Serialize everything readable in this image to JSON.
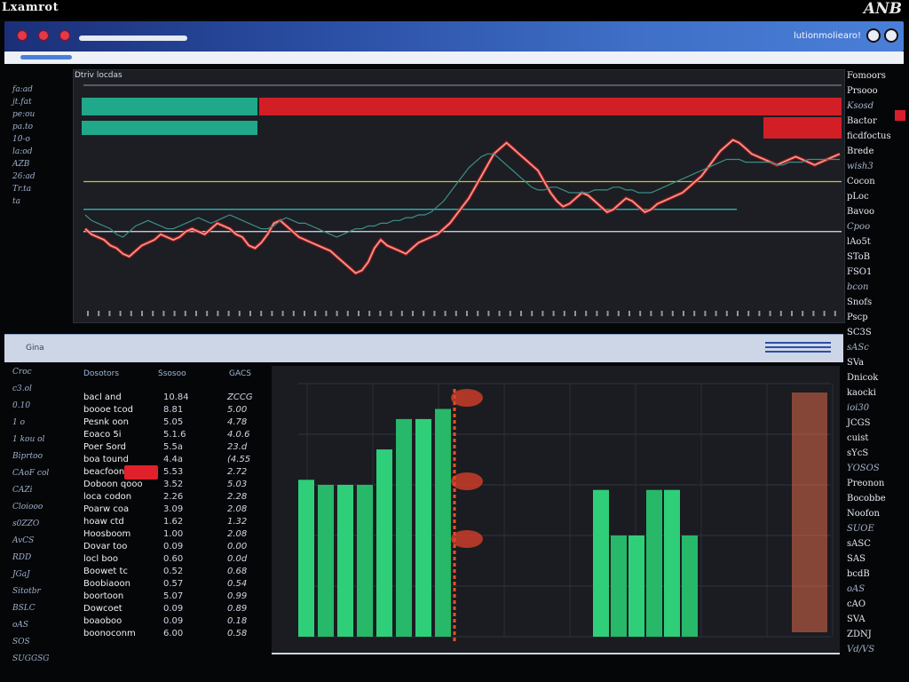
{
  "window": {
    "app_title": "Lxamrot",
    "logo_text": "ANB"
  },
  "topbar": {
    "right_text": "lutionmoliearo!",
    "icons": [
      "gear-icon",
      "user-icon"
    ]
  },
  "price_chart": {
    "title": "Dtriv locdas",
    "left_labels": [
      "fa:ad",
      "jt.fat",
      "pe:ou",
      "pa.to",
      "10-o",
      "la:od",
      "AZB",
      "26:ad",
      "Tr.ta",
      "ta"
    ]
  },
  "right_panel": {
    "labels": [
      "Fomoors",
      "Prsooo",
      "Ksosd",
      "Bactor",
      "ficdfoctus",
      "Brede",
      "wish3",
      "Cocon",
      "pLoc",
      "Bavoo",
      "Cpoo",
      "lAo5t",
      "SToB",
      "FSO1",
      "bcon",
      "Snofs",
      "Pscp",
      "SC3S",
      "sASc",
      "SVa",
      "Dnicok",
      "kaocki",
      "ioi30",
      "JCGS",
      "cuist",
      "sYcS",
      "YOSOS",
      "Preonon",
      "Bocobbe",
      "Noofon",
      "SUOE",
      "sASC",
      "SAS",
      "bcdB",
      "oAS",
      "cAO",
      "SVA",
      "ZDNJ",
      "Vd/VS"
    ]
  },
  "separator": {
    "label": "Gina"
  },
  "left_bottom": {
    "labels": [
      "Croc",
      "c3.ol",
      "0.10",
      "1 o",
      "1 kou ol",
      "Biprtoo",
      "CAoF col",
      "CAZi",
      "Cloiooo",
      "s0ZZO",
      "AvCS",
      "RDD",
      "JGaJ",
      "Sitotbr",
      "BSLC",
      "oAS",
      "SOS",
      "SUGGSG"
    ]
  },
  "table": {
    "headers": [
      "Dosotors",
      "Ssosoo",
      "GACS"
    ],
    "rows": [
      [
        "bacl and",
        "10.84",
        "ZCCG"
      ],
      [
        "boooe tcod",
        "8.81",
        "5.00"
      ],
      [
        "Pesnk oon",
        "5.05",
        "4.78"
      ],
      [
        "Eoaco 5i",
        "5.1.6",
        "4.0.6"
      ],
      [
        "Poer Sord",
        "5.5a",
        "23.d"
      ],
      [
        "boa tound",
        "4.4a",
        "(4.55"
      ],
      [
        "beacfoon",
        "5.53",
        "2.72"
      ],
      [
        "Doboon qooo",
        "3.52",
        "5.03"
      ],
      [
        "loca codon",
        "2.26",
        "2.28"
      ],
      [
        "Poarw coa",
        "3.09",
        "2.08"
      ],
      [
        "hoaw ctd",
        "1.62",
        "1.32"
      ],
      [
        "Hoosboom",
        "1.00",
        "2.08"
      ],
      [
        "Dovar too",
        "0.09",
        "0.00"
      ],
      [
        "locl boo",
        "0.60",
        "0.0d"
      ],
      [
        "Boowet tc",
        "0.52",
        "0.68"
      ],
      [
        "Boobiaoon",
        "0.57",
        "0.54"
      ],
      [
        "boortoon",
        "5.07",
        "0.99"
      ],
      [
        "Dowcoet",
        "0.09",
        "0.89"
      ],
      [
        "boaoboo",
        "0.09",
        "0.18"
      ],
      [
        "boonoconm",
        "6.00",
        "0.58"
      ]
    ]
  },
  "chart_data": [
    {
      "type": "line",
      "x": [
        0,
        1,
        2,
        3,
        4,
        5,
        6,
        7,
        8,
        9,
        10,
        11,
        12,
        13,
        14,
        15,
        16,
        17,
        18,
        19,
        20,
        21,
        22,
        23,
        24,
        25,
        26,
        27,
        28,
        29,
        30,
        31,
        32,
        33,
        34,
        35,
        36,
        37,
        38,
        39,
        40,
        41,
        42,
        43,
        44,
        45,
        46,
        47,
        48,
        49,
        50,
        51,
        52,
        53,
        54,
        55,
        56,
        57,
        58,
        59,
        60,
        61,
        62,
        63,
        64,
        65,
        66,
        67,
        68,
        69,
        70,
        71,
        72,
        73,
        74,
        75,
        76,
        77,
        78,
        79,
        80,
        81,
        82,
        83,
        84,
        85,
        86,
        87,
        88,
        89,
        90,
        91,
        92,
        93,
        94,
        95,
        96,
        97,
        98,
        99,
        100,
        101,
        102,
        103,
        104,
        105,
        106,
        107,
        108,
        109,
        110,
        111,
        112,
        113,
        114,
        115,
        116,
        117,
        118,
        119,
        120
      ],
      "series": [
        {
          "values": [
            47,
            45,
            44,
            43,
            41,
            40,
            38,
            37,
            39,
            41,
            42,
            43,
            45,
            44,
            43,
            44,
            46,
            47,
            46,
            45,
            47,
            49,
            48,
            47,
            45,
            44,
            41,
            40,
            42,
            45,
            49,
            50,
            48,
            46,
            44,
            43,
            42,
            41,
            40,
            39,
            37,
            35,
            33,
            31,
            32,
            35,
            40,
            43,
            41,
            40,
            39,
            38,
            40,
            42,
            43,
            44,
            45,
            47,
            49,
            52,
            55,
            58,
            62,
            66,
            70,
            74,
            76,
            78,
            76,
            74,
            72,
            70,
            68,
            64,
            60,
            57,
            55,
            56,
            58,
            60,
            59,
            57,
            55,
            53,
            54,
            56,
            58,
            57,
            55,
            53,
            54,
            56,
            57,
            58,
            59,
            60,
            62,
            64,
            66,
            69,
            72,
            75,
            77,
            79,
            78,
            76,
            74,
            73,
            72,
            71,
            70,
            71,
            72,
            73,
            72,
            71,
            70,
            71,
            72,
            73,
            74
          ]
        },
        {
          "values": [
            52,
            50,
            49,
            48,
            47,
            45,
            44,
            46,
            48,
            49,
            50,
            49,
            48,
            47,
            47,
            48,
            49,
            50,
            51,
            50,
            49,
            50,
            51,
            52,
            51,
            50,
            49,
            48,
            47,
            47,
            48,
            50,
            51,
            50,
            49,
            49,
            48,
            47,
            46,
            45,
            44,
            45,
            46,
            47,
            47,
            48,
            48,
            49,
            49,
            50,
            50,
            51,
            51,
            52,
            52,
            53,
            55,
            57,
            60,
            63,
            66,
            69,
            71,
            73,
            74,
            74,
            72,
            70,
            68,
            66,
            64,
            62,
            61,
            61,
            62,
            62,
            61,
            60,
            60,
            60,
            60,
            61,
            61,
            61,
            62,
            62,
            61,
            61,
            60,
            60,
            60,
            61,
            62,
            63,
            64,
            65,
            66,
            67,
            68,
            69,
            70,
            71,
            72,
            72,
            72,
            71,
            71,
            71,
            71,
            71,
            70,
            70,
            71,
            71,
            71,
            72,
            72,
            72,
            72,
            72,
            72
          ]
        }
      ],
      "reference_lines": [
        64,
        54,
        46
      ],
      "ylim": [
        20,
        100
      ]
    },
    {
      "type": "bar",
      "categories": [
        "c1",
        "c2",
        "c3",
        "c4",
        "c5",
        "c6",
        "c7",
        "c8",
        "c9",
        "c10",
        "c11",
        "c12",
        "c13",
        "c14",
        "c15",
        "c16",
        "c17",
        "c18",
        "c19",
        "c20",
        "c21",
        "c22",
        "c23",
        "c24",
        "c25",
        "c26"
      ],
      "values": [
        62,
        60,
        60,
        60,
        74,
        86,
        86,
        90,
        0,
        0,
        0,
        0,
        0,
        0,
        0,
        0,
        0,
        0,
        0,
        0,
        58,
        40,
        40,
        58,
        58,
        40
      ],
      "ylim": [
        0,
        100
      ]
    }
  ]
}
